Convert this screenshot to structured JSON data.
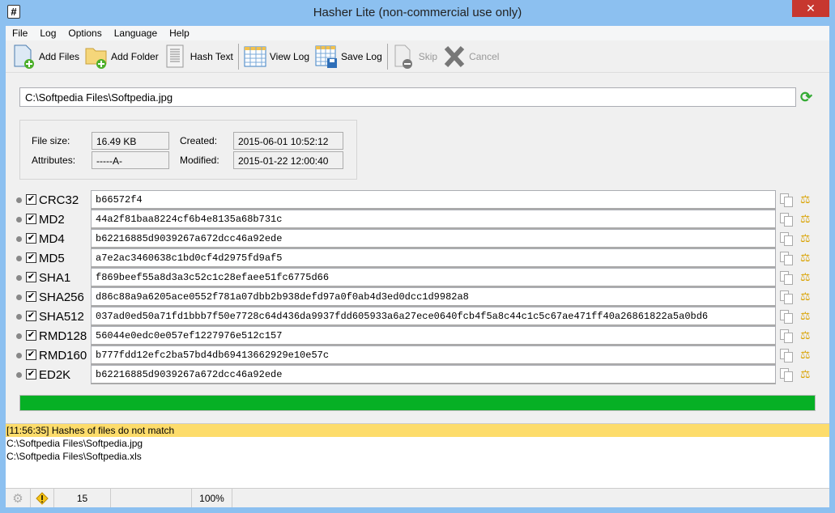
{
  "window": {
    "title": "Hasher Lite (non-commercial use only)",
    "app_icon": "#",
    "close": "✕"
  },
  "menu": [
    "File",
    "Log",
    "Options",
    "Language",
    "Help"
  ],
  "toolbar": {
    "add_files": "Add Files",
    "add_folder": "Add Folder",
    "hash_text": "Hash Text",
    "view_log": "View Log",
    "save_log": "Save Log",
    "skip": "Skip",
    "cancel": "Cancel"
  },
  "path": "C:\\Softpedia Files\\Softpedia.jpg",
  "info": {
    "file_size_label": "File size:",
    "file_size": "16.49 KB",
    "attributes_label": "Attributes:",
    "attributes": "-----A-",
    "created_label": "Created:",
    "created": "2015-06-01 10:52:12",
    "modified_label": "Modified:",
    "modified": "2015-01-22 12:00:40"
  },
  "hashes": [
    {
      "algo": "CRC32",
      "value": "b66572f4"
    },
    {
      "algo": "MD2",
      "value": "44a2f81baa8224cf6b4e8135a68b731c"
    },
    {
      "algo": "MD4",
      "value": "b62216885d9039267a672dcc46a92ede"
    },
    {
      "algo": "MD5",
      "value": "a7e2ac3460638c1bd0cf4d2975fd9af5"
    },
    {
      "algo": "SHA1",
      "value": "f869beef55a8d3a3c52c1c28efaee51fc6775d66"
    },
    {
      "algo": "SHA256",
      "value": "d86c88a9a6205ace0552f781a07dbb2b938defd97a0f0ab4d3ed0dcc1d9982a8"
    },
    {
      "algo": "SHA512",
      "value": "037ad0ed50a71fd1bbb7f50e7728c64d436da9937fdd605933a6a27ece0640fcb4f5a8c44c1c5c67ae471ff40a26861822a5a0bd6"
    },
    {
      "algo": "RMD128",
      "value": "56044e0edc0e057ef1227976e512c157"
    },
    {
      "algo": "RMD160",
      "value": "b777fdd12efc2ba57bd4db69413662929e10e57c"
    },
    {
      "algo": "ED2K",
      "value": "b62216885d9039267a672dcc46a92ede"
    }
  ],
  "progress_percent": 100,
  "progress_color": "#06b025",
  "log": [
    "[11:56:35] Hashes of files do not match",
    "C:\\Softpedia Files\\Softpedia.jpg",
    "C:\\Softpedia Files\\Softpedia.xls"
  ],
  "status": {
    "count": "15",
    "percent": "100%"
  }
}
